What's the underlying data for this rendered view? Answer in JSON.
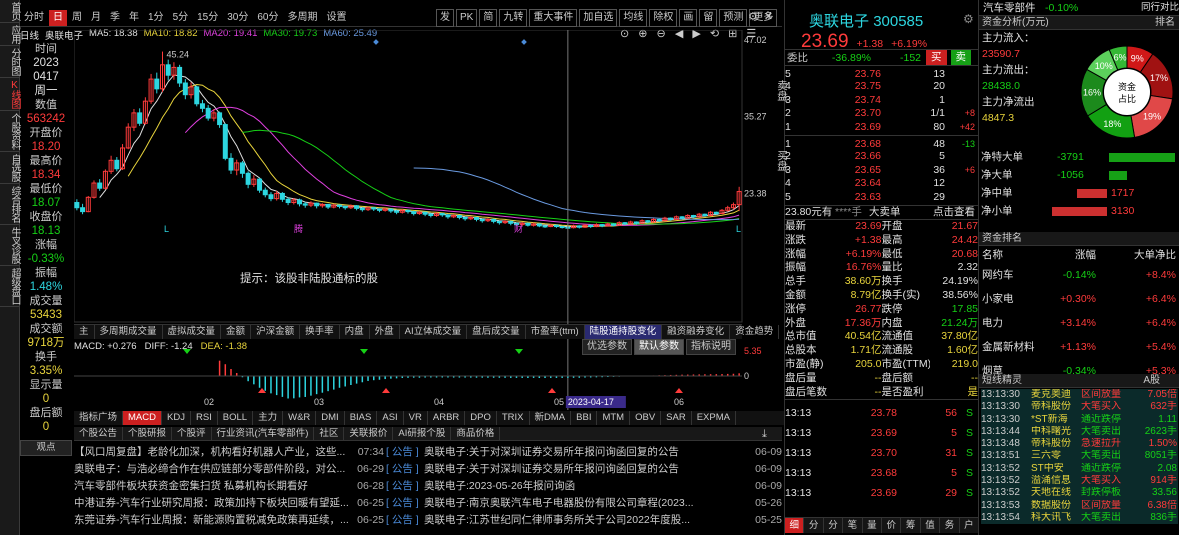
{
  "sidebar": [
    {
      "label": "首页",
      "on": false
    },
    {
      "label": "应用",
      "on": false
    },
    {
      "label": "分时图",
      "on": false
    },
    {
      "label": "K线图",
      "on": true
    },
    {
      "label": "个股资料",
      "on": false
    },
    {
      "label": "自选股",
      "on": false
    },
    {
      "label": "综合排名",
      "on": false
    },
    {
      "label": "牛叉诊股",
      "on": false
    },
    {
      "label": "超级盘口",
      "on": false
    }
  ],
  "toolbar": {
    "items": [
      "分时",
      "日",
      "周",
      "月",
      "季",
      "年",
      "1分",
      "5分",
      "15分",
      "30分",
      "60分",
      "多周期",
      "设置"
    ],
    "selected": "日",
    "right": [
      "发",
      "PK",
      "简",
      "九转",
      "重大事件",
      "加自选",
      "均线",
      "除权",
      "画",
      "留",
      "预测",
      "更多"
    ]
  },
  "window_controls": [
    "⚙",
    "✕"
  ],
  "ma_legend": {
    "period": "日线",
    "name": "奥联电子",
    "ma5": "MA5: 18.38",
    "ma10": "MA10: 18.82",
    "ma20": "MA20: 19.41",
    "ma30": "MA30: 19.73",
    "ma60": "MA60: 25.49"
  },
  "left_info": {
    "time_label": "时间",
    "year": "2023",
    "date": "0417",
    "weekday": "周一",
    "count_label": "数值",
    "count": "563242",
    "open_label": "开盘价",
    "open": "18.20",
    "high_label": "最高价",
    "high": "18.34",
    "low_label": "最低价",
    "low": "18.07",
    "close_label": "收盘价",
    "close": "18.13",
    "chg_label": "涨幅",
    "chg": "-0.33%",
    "amp_label": "振幅",
    "amp": "1.48%",
    "vol_label": "成交量",
    "vol": "53433",
    "amt_label": "成交额",
    "amt": "9718万",
    "turn_label": "换手",
    "turn": "3.35%",
    "show_label": "显示量",
    "show_val": "0",
    "after_label": "盘后额",
    "after_val": "0",
    "footer": "观点"
  },
  "kchart": {
    "price_high": "47.02",
    "price_mid": "35.27",
    "price_low": "23.38",
    "peak_label": "45.24",
    "hint": "提示：该股非陆股通标的股",
    "markers": [
      "L",
      "腾",
      "财",
      "L"
    ],
    "candles": [
      [
        22,
        21.2,
        22.5,
        20.8
      ],
      [
        21.2,
        20.6,
        21.8,
        20.2
      ],
      [
        20.6,
        22.8,
        23.0,
        20.5
      ],
      [
        22.8,
        25.0,
        25.4,
        22.6
      ],
      [
        25.0,
        24.2,
        25.6,
        23.8
      ],
      [
        24.2,
        26.8,
        27.1,
        24.0
      ],
      [
        26.8,
        28.5,
        29.2,
        26.4
      ],
      [
        28.5,
        27.2,
        29.0,
        26.8
      ],
      [
        27.2,
        30.4,
        31.0,
        27.0
      ],
      [
        30.4,
        33.6,
        34.2,
        30.2
      ],
      [
        33.6,
        35.8,
        36.4,
        33.0
      ],
      [
        35.8,
        34.2,
        36.5,
        33.8
      ],
      [
        34.2,
        37.6,
        38.2,
        34.0
      ],
      [
        37.6,
        41.0,
        41.8,
        37.2
      ],
      [
        41.0,
        39.5,
        42.0,
        38.8
      ],
      [
        39.5,
        43.2,
        45.24,
        39.0
      ],
      [
        43.2,
        41.6,
        44.0,
        40.8
      ],
      [
        41.6,
        42.8,
        43.6,
        40.9
      ],
      [
        42.8,
        40.4,
        43.2,
        39.8
      ],
      [
        40.4,
        38.6,
        41.0,
        37.9
      ],
      [
        38.6,
        39.8,
        40.5,
        38.0
      ],
      [
        39.8,
        37.2,
        40.0,
        36.8
      ],
      [
        37.2,
        36.5,
        37.8,
        35.9
      ],
      [
        36.5,
        35.0,
        37.0,
        34.6
      ],
      [
        35.0,
        35.8,
        36.4,
        34.5
      ],
      [
        35.8,
        34.0,
        36.0,
        33.5
      ],
      [
        34.0,
        28.8,
        34.2,
        28.5
      ],
      [
        28.8,
        27.0,
        29.6,
        26.4
      ],
      [
        27.0,
        28.1,
        28.6,
        26.2
      ],
      [
        28.1,
        26.5,
        28.4,
        25.8
      ],
      [
        26.5,
        24.8,
        26.8,
        24.2
      ],
      [
        24.8,
        25.6,
        26.2,
        24.4
      ],
      [
        25.6,
        23.9,
        25.8,
        23.5
      ],
      [
        23.9,
        23.2,
        24.3,
        22.8
      ],
      [
        23.2,
        22.6,
        23.6,
        22.2
      ],
      [
        22.6,
        23.4,
        23.8,
        22.3
      ],
      [
        23.4,
        22.5,
        23.6,
        22.1
      ],
      [
        22.5,
        22.0,
        22.8,
        21.6
      ],
      [
        22.0,
        22.4,
        22.7,
        21.7
      ],
      [
        22.4,
        21.8,
        22.6,
        21.4
      ],
      [
        21.8,
        21.6,
        22.1,
        21.2
      ],
      [
        21.6,
        21.9,
        22.2,
        21.3
      ],
      [
        21.9,
        21.5,
        22.0,
        21.1
      ],
      [
        21.5,
        21.7,
        21.9,
        21.2
      ],
      [
        21.7,
        21.3,
        21.8,
        21.0
      ],
      [
        21.3,
        21.6,
        21.8,
        21.1
      ],
      [
        21.6,
        21.4,
        21.7,
        21.1
      ],
      [
        21.4,
        21.2,
        21.5,
        20.9
      ],
      [
        21.2,
        21.5,
        21.7,
        21.0
      ],
      [
        21.5,
        21.1,
        21.6,
        20.8
      ],
      [
        21.1,
        20.9,
        21.3,
        20.6
      ],
      [
        20.9,
        21.2,
        21.4,
        20.7
      ],
      [
        21.2,
        21.0,
        21.3,
        20.7
      ],
      [
        21.0,
        20.8,
        21.1,
        20.5
      ],
      [
        20.8,
        21.0,
        21.2,
        20.6
      ],
      [
        21.0,
        20.7,
        21.1,
        20.4
      ],
      [
        20.7,
        20.5,
        20.9,
        20.2
      ],
      [
        20.5,
        20.8,
        21.0,
        20.3
      ],
      [
        20.8,
        20.6,
        20.9,
        20.3
      ],
      [
        20.6,
        20.3,
        20.7,
        20.0
      ],
      [
        20.3,
        20.5,
        20.7,
        20.1
      ],
      [
        20.5,
        20.2,
        20.6,
        19.9
      ],
      [
        20.2,
        20.0,
        20.4,
        19.7
      ],
      [
        20.0,
        20.3,
        20.5,
        19.8
      ],
      [
        20.3,
        20.1,
        20.4,
        19.8
      ],
      [
        20.1,
        19.8,
        20.2,
        19.5
      ],
      [
        19.8,
        20.0,
        20.2,
        19.6
      ],
      [
        20.0,
        19.7,
        20.1,
        19.4
      ],
      [
        19.7,
        19.5,
        19.8,
        19.2
      ],
      [
        19.5,
        19.7,
        19.9,
        19.3
      ],
      [
        19.7,
        19.4,
        19.8,
        19.1
      ],
      [
        19.4,
        19.2,
        19.5,
        18.9
      ],
      [
        19.2,
        19.4,
        19.6,
        19.0
      ],
      [
        19.4,
        19.1,
        19.5,
        18.8
      ],
      [
        19.1,
        18.9,
        19.2,
        18.6
      ],
      [
        18.9,
        19.1,
        19.3,
        18.7
      ],
      [
        19.1,
        18.8,
        19.2,
        18.5
      ],
      [
        18.8,
        18.6,
        18.9,
        18.4
      ],
      [
        18.6,
        18.8,
        19.0,
        18.4
      ],
      [
        18.8,
        18.5,
        18.9,
        18.3
      ],
      [
        18.5,
        18.7,
        18.9,
        18.3
      ],
      [
        18.7,
        18.4,
        18.8,
        18.2
      ],
      [
        18.4,
        18.3,
        18.5,
        18.1
      ],
      [
        18.3,
        18.5,
        18.7,
        18.2
      ],
      [
        18.5,
        18.3,
        18.6,
        18.1
      ],
      [
        18.3,
        18.2,
        18.4,
        18.0
      ],
      [
        18.2,
        18.13,
        18.34,
        18.07
      ],
      [
        18.13,
        18.4,
        18.6,
        18.0
      ],
      [
        18.4,
        18.2,
        18.5,
        18.0
      ],
      [
        18.2,
        18.5,
        18.7,
        18.1
      ],
      [
        18.5,
        18.3,
        18.6,
        18.1
      ],
      [
        18.3,
        18.6,
        18.8,
        18.2
      ],
      [
        18.6,
        18.4,
        18.7,
        18.2
      ],
      [
        18.4,
        18.7,
        18.9,
        18.3
      ],
      [
        18.7,
        18.5,
        18.8,
        18.3
      ],
      [
        18.5,
        18.9,
        19.1,
        18.4
      ],
      [
        18.9,
        18.7,
        19.0,
        18.5
      ],
      [
        18.7,
        19.0,
        19.2,
        18.6
      ],
      [
        19.0,
        18.8,
        19.1,
        18.6
      ],
      [
        18.8,
        19.2,
        19.4,
        18.7
      ],
      [
        19.2,
        19.0,
        19.3,
        18.8
      ],
      [
        19.0,
        19.4,
        19.6,
        18.9
      ],
      [
        19.4,
        19.2,
        19.5,
        19.0
      ],
      [
        19.2,
        19.6,
        19.8,
        19.1
      ],
      [
        19.6,
        19.4,
        19.7,
        19.2
      ],
      [
        19.4,
        19.8,
        20.0,
        19.3
      ],
      [
        19.8,
        19.6,
        19.9,
        19.4
      ],
      [
        19.6,
        20.0,
        20.2,
        19.5
      ],
      [
        20.0,
        19.8,
        20.1,
        19.6
      ],
      [
        19.8,
        20.2,
        20.4,
        19.7
      ],
      [
        20.2,
        20.0,
        20.3,
        19.8
      ],
      [
        20.0,
        20.5,
        20.7,
        19.9
      ],
      [
        20.5,
        20.3,
        20.6,
        20.1
      ],
      [
        20.3,
        20.8,
        21.0,
        20.2
      ],
      [
        20.8,
        21.2,
        21.5,
        20.6
      ],
      [
        21.2,
        21.67,
        22.0,
        20.9
      ],
      [
        21.67,
        23.69,
        24.42,
        20.68
      ]
    ]
  },
  "ind_tabs": [
    "主",
    "多周期成交量",
    "虚拟成交量",
    "金额",
    "沪深金额",
    "换手率",
    "内盘",
    "外盘",
    "AI立体成交量",
    "盘后成交量",
    "市盈率(ttm)",
    "陆股通持股变化",
    "融资融券变化",
    "资金趋势"
  ],
  "ind_tab_sel": "陆股通持股变化",
  "macd": {
    "title": "MACD",
    "diff": "DIFF: -1.24",
    "dea": "DEA: -1.38",
    "val": "MACD: +0.276",
    "y_top": "5.35",
    "y_zero": "0",
    "x_labels": [
      "02",
      "03",
      "04",
      "05",
      "06"
    ],
    "cursor_date": "2023-04-17"
  },
  "param_tabs": [
    "优选参数",
    "默认参数",
    "指标说明"
  ],
  "param_sel": "默认参数",
  "bottom_tabs": [
    "指标广场",
    "MACD",
    "KDJ",
    "RSI",
    "BOLL",
    "主力",
    "W&R",
    "DMI",
    "BIAS",
    "ASI",
    "VR",
    "ARBR",
    "DPO",
    "TRIX",
    "新DMA",
    "BBI",
    "MTM",
    "OBV",
    "SAR",
    "EXPMA"
  ],
  "bottom_sel": "MACD",
  "news_tabs": [
    "个股公告",
    "个股研报",
    "个股评",
    "行业资讯(汽车零部件)",
    "社区",
    "关联报价",
    "AI研报个股",
    "商品价格"
  ],
  "news_left": [
    {
      "t": "【风口周复盘】老龄化加深，机构看好机器人产业，这些...",
      "d": "07:34"
    },
    {
      "t": "奥联电子：与浩必缔合作在供应链部分零部件阶段，对公...",
      "d": "06-29"
    },
    {
      "t": "汽车零部件板块获资金密集扫货 私募机构长期看好",
      "d": "06-28"
    },
    {
      "t": "中港证券-汽车行业研究周报：政策加持下板块回暖有望延...",
      "d": "06-25"
    },
    {
      "t": "东莞证券-汽车行业周报：新能源购置税减免政策再延续，...",
      "d": "06-25"
    }
  ],
  "news_right": [
    {
      "tag": "[ 公告 ]",
      "t": "奥联电子:关于对深圳证券交易所年报问询函回复的公告",
      "d": "06-09"
    },
    {
      "tag": "[ 公告 ]",
      "t": "奥联电子:关于对深圳证券交易所年报问询函回复的公告",
      "d": "06-09"
    },
    {
      "tag": "[ 公告 ]",
      "t": "奥联电子:2023-05-26年报问询函",
      "d": "06-09"
    },
    {
      "tag": "[ 公告 ]",
      "t": "奥联电子:南京奥联汽车电子电器股份有限公司章程(2023...",
      "d": "05-26"
    },
    {
      "tag": "[ 公告 ]",
      "t": "奥联电子:江苏世纪同仁律师事务所关于公司2022年度股...",
      "d": "05-25"
    }
  ],
  "quote": {
    "name": "奥联电子",
    "code": "300585",
    "price": "23.69",
    "chg": "+1.38",
    "pct": "+6.19%",
    "webi_label": "委比",
    "webi": "-36.89%",
    "wecha": "-152",
    "buy_btn": "买",
    "sell_btn": "卖",
    "sells": [
      [
        "5",
        "23.76",
        "13",
        ""
      ],
      [
        "4",
        "23.75",
        "20",
        ""
      ],
      [
        "3",
        "23.74",
        "1",
        ""
      ],
      [
        "2",
        "23.70",
        "1/1",
        "+8"
      ],
      [
        "1",
        "23.69",
        "80",
        "+42"
      ]
    ],
    "buys": [
      [
        "1",
        "23.68",
        "48",
        "-13"
      ],
      [
        "2",
        "23.66",
        "5",
        ""
      ],
      [
        "3",
        "23.65",
        "36",
        "+6"
      ],
      [
        "4",
        "23.64",
        "12",
        ""
      ],
      [
        "5",
        "23.63",
        "29",
        ""
      ]
    ],
    "sell_label": "卖盘",
    "buy_label": "买盘",
    "big": [
      "23.80元有",
      "****手",
      "大卖单",
      "点击查看"
    ],
    "stats": [
      [
        "最新",
        "23.69",
        "开盘",
        "21.67"
      ],
      [
        "涨跌",
        "+1.38",
        "最高",
        "24.42"
      ],
      [
        "涨幅",
        "+6.19%",
        "最低",
        "20.68"
      ],
      [
        "振幅",
        "16.76%",
        "量比",
        "2.32"
      ],
      [
        "总手",
        "38.60万",
        "换手",
        "24.19%"
      ],
      [
        "金额",
        "8.79亿",
        "换手(实)",
        "38.56%"
      ],
      [
        "涨停",
        "26.77",
        "跌停",
        "17.85"
      ],
      [
        "外盘",
        "17.36万",
        "内盘",
        "21.24万"
      ],
      [
        "总市值",
        "40.54亿",
        "流通值",
        "37.80亿"
      ],
      [
        "总股本",
        "1.71亿",
        "流通股",
        "1.60亿"
      ],
      [
        "市盈(静)",
        "205.0",
        "市盈(TTM)",
        "219.0"
      ],
      [
        "盘后量",
        "--",
        "盘后额",
        "--"
      ],
      [
        "盘后笔数",
        "--",
        "是否盈利",
        "是"
      ]
    ],
    "trades": [
      [
        "13:13",
        "23.78",
        "56",
        "S"
      ],
      [
        "13:13",
        "23.69",
        "5",
        "S"
      ],
      [
        "13:13",
        "23.70",
        "31",
        "S"
      ],
      [
        "13:13",
        "23.68",
        "5",
        "S"
      ],
      [
        "13:13",
        "23.69",
        "29",
        "S"
      ]
    ],
    "tabs": [
      "细",
      "分",
      "分",
      "笔",
      "量",
      "价",
      "筹",
      "值",
      "务",
      "户"
    ]
  },
  "right": {
    "sector": "汽车零部件",
    "sector_pct": "-0.10%",
    "peer": "同行对比",
    "flow_title": "资金分析(万元)",
    "flow_rank": "排名",
    "flow": [
      [
        "主力流入：",
        "23590.7"
      ],
      [
        "主力流出：",
        "28438.0"
      ],
      [
        "主力净流出",
        "4847.3"
      ]
    ],
    "pie": {
      "center": "资金占比",
      "slices": [
        {
          "label": "9%",
          "value": 9,
          "color": "#d01818"
        },
        {
          "label": "17%",
          "value": 17,
          "color": "#a01212"
        },
        {
          "label": "19%",
          "value": 19,
          "color": "#e04848"
        },
        {
          "label": "18%",
          "value": 18,
          "color": "#12a012"
        },
        {
          "label": "16%",
          "value": 16,
          "color": "#1c8a1c"
        },
        {
          "label": "10%",
          "value": 10,
          "color": "#5cd05c"
        },
        {
          "label": "6%",
          "value": 6,
          "color": "#35b835"
        }
      ]
    },
    "bars": [
      {
        "label": "净特大单",
        "value": "-3791",
        "num": -3791
      },
      {
        "label": "净大单",
        "value": "-1056",
        "num": -1056
      },
      {
        "label": "净中单",
        "value": "1717",
        "num": 1717
      },
      {
        "label": "净小单",
        "value": "3130",
        "num": 3130
      }
    ],
    "sect_title": "资金排名",
    "sect_head": [
      "名称",
      "涨幅",
      "大单净比"
    ],
    "sectors": [
      [
        "网约车",
        "-0.14%",
        "+8.4%"
      ],
      [
        "小家电",
        "+0.30%",
        "+6.4%"
      ],
      [
        "电力",
        "+3.14%",
        "+6.4%"
      ],
      [
        "金属新材料",
        "+1.13%",
        "+5.4%"
      ],
      [
        "烟草",
        "-0.34%",
        "+5.3%"
      ]
    ],
    "lh_title": "短线精灵",
    "lh_filter": "A股",
    "lh": [
      [
        "13:13:30",
        "麦克奥迪",
        "区间放量",
        "7.05倍"
      ],
      [
        "13:13:30",
        "帝科股份",
        "大笔买入",
        "632手"
      ],
      [
        "13:13:30",
        "*ST新海",
        "通近跌停",
        "1.11"
      ],
      [
        "13:13:44",
        "中科曙光",
        "大笔卖出",
        "2623手"
      ],
      [
        "13:13:48",
        "帝科股份",
        "急速拉升",
        "1.50%"
      ],
      [
        "13:13:51",
        "三六零",
        "大笔卖出",
        "8051手"
      ],
      [
        "13:13:52",
        "ST中安",
        "通近跌停",
        "2.08"
      ],
      [
        "13:13:52",
        "溢涌信息",
        "大笔买入",
        "914手"
      ],
      [
        "13:13:52",
        "天地在线",
        "封跌停板",
        "33.56"
      ],
      [
        "13:13:53",
        "数据股份",
        "区间放量",
        "6.38倍"
      ],
      [
        "13:13:54",
        "科大讯飞",
        "大笔卖出",
        "836手"
      ]
    ]
  }
}
